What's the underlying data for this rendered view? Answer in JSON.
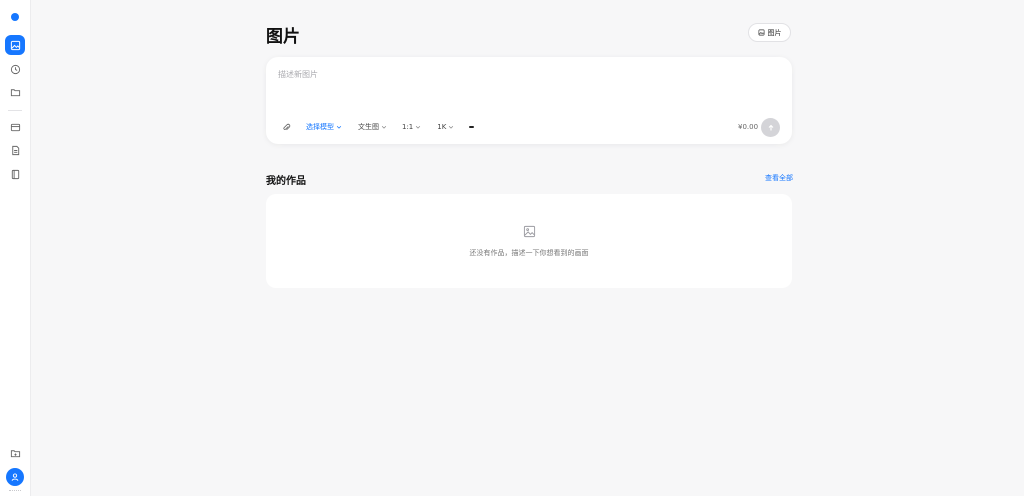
{
  "app": {
    "accent_color": "#1677ff"
  },
  "sidebar": {
    "items": [
      {
        "name": "image",
        "icon": "image-icon",
        "active": true
      },
      {
        "name": "history",
        "icon": "clock-icon",
        "active": false
      },
      {
        "name": "folder",
        "icon": "folder-icon",
        "active": false
      },
      {
        "name": "card",
        "icon": "card-icon",
        "active": false
      },
      {
        "name": "document",
        "icon": "document-icon",
        "active": false
      },
      {
        "name": "book",
        "icon": "book-icon",
        "active": false
      }
    ],
    "bottom": [
      {
        "name": "files",
        "icon": "folder-files-icon"
      },
      {
        "name": "profile",
        "icon": "user-icon"
      }
    ]
  },
  "header": {
    "title": "图片",
    "pill_label": "图片"
  },
  "composer": {
    "placeholder": "描述新图片",
    "toolbar": {
      "model": "选择模型",
      "mode": "文生图",
      "ratio": "1:1",
      "resolution": "1K"
    },
    "price": "¥0.00"
  },
  "works": {
    "title": "我的作品",
    "view_all": "查看全部",
    "empty_text": "还没有作品，描述一下你想看到的画面"
  }
}
